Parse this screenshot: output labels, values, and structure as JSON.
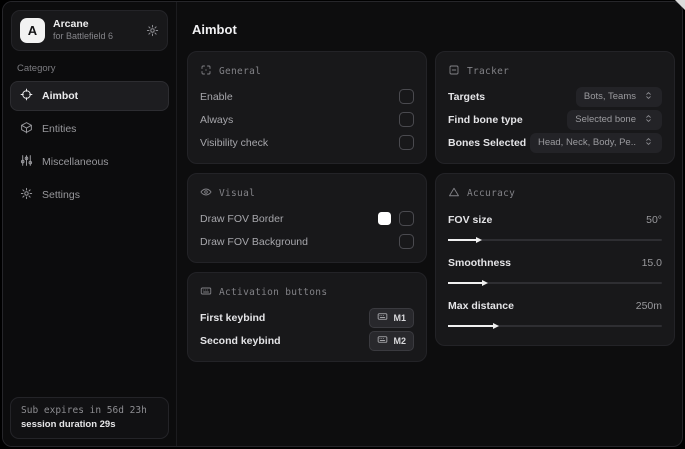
{
  "sidebar": {
    "brand": {
      "logo_letter": "A",
      "title": "Arcane",
      "subtitle": "for Battlefield 6"
    },
    "category_label": "Category",
    "items": [
      {
        "label": "Aimbot",
        "icon": "crosshair-icon",
        "active": true
      },
      {
        "label": "Entities",
        "icon": "entities-icon",
        "active": false
      },
      {
        "label": "Miscellaneous",
        "icon": "sliders-icon",
        "active": false
      },
      {
        "label": "Settings",
        "icon": "gear-icon",
        "active": false
      }
    ],
    "subscription": {
      "expires": "Sub expires in 56d 23h",
      "session": "session duration 29s"
    }
  },
  "main": {
    "title": "Aimbot",
    "general": {
      "title": "General",
      "rows": [
        {
          "label": "Enable",
          "checked": false
        },
        {
          "label": "Always",
          "checked": false
        },
        {
          "label": "Visibility check",
          "checked": false
        }
      ]
    },
    "visual": {
      "title": "Visual",
      "rows": [
        {
          "label": "Draw FOV Border",
          "swatch_color": "#ffffff",
          "checked": false
        },
        {
          "label": "Draw FOV Background",
          "checked": false
        }
      ]
    },
    "activation": {
      "title": "Activation buttons",
      "rows": [
        {
          "label": "First keybind",
          "key": "M1"
        },
        {
          "label": "Second keybind",
          "key": "M2"
        }
      ]
    },
    "tracker": {
      "title": "Tracker",
      "rows": [
        {
          "label": "Targets",
          "value": "Bots, Teams"
        },
        {
          "label": "Find bone type",
          "value": "Selected bone"
        },
        {
          "label": "Bones Selected",
          "value": "Head, Neck, Body, Pe.."
        }
      ]
    },
    "accuracy": {
      "title": "Accuracy",
      "rows": [
        {
          "label": "FOV size",
          "value": "50°",
          "fill_pct": 13
        },
        {
          "label": "Smoothness",
          "value": "15.0",
          "fill_pct": 16
        },
        {
          "label": "Max distance",
          "value": "250m",
          "fill_pct": 21
        }
      ]
    }
  },
  "colors": {
    "accent_fill": "#f0f0f0",
    "card_bg": "#18181a",
    "window_bg": "#0d0d0e",
    "swatch": "#ffffff"
  }
}
